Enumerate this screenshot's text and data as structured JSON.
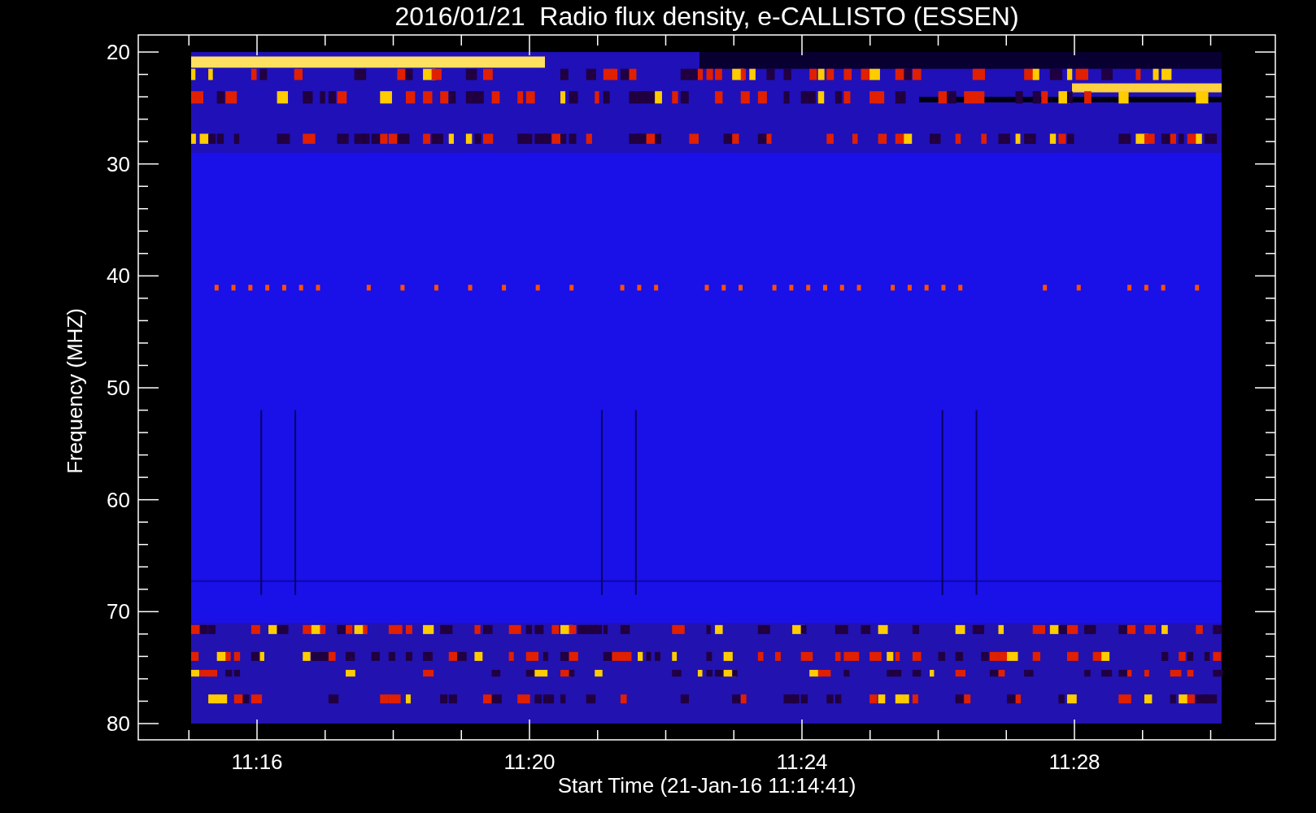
{
  "title": "2016/01/21  Radio flux density, e-CALLISTO (ESSEN)",
  "y_axis": {
    "label": "Frequency (MHZ)",
    "ticks": [
      "20",
      "30",
      "40",
      "50",
      "60",
      "70",
      "80"
    ]
  },
  "x_axis": {
    "label": "Start Time (21-Jan-16 11:14:41)",
    "ticks": [
      "11:16",
      "11:20",
      "11:24",
      "11:28"
    ]
  }
}
